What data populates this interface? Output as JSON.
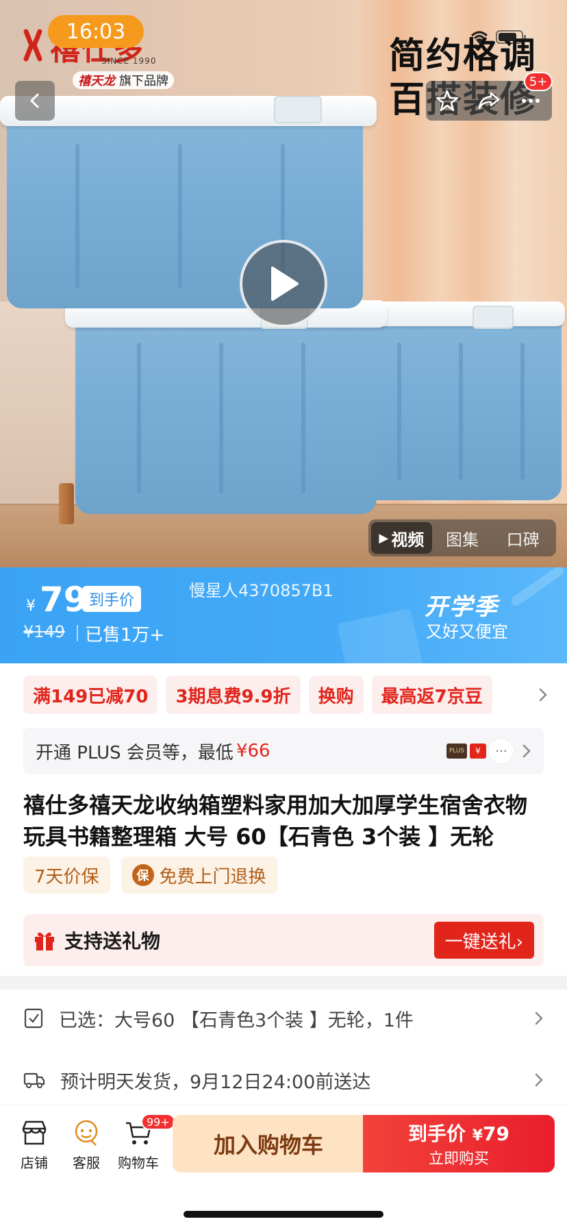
{
  "status_bar": {
    "time": "16:03"
  },
  "hero": {
    "brand_name": "禧仕多",
    "brand_since": "SINCE 1990",
    "brand_tag_brand": "禧天龙",
    "brand_tag_suffix": "旗下品牌",
    "slogan_line1": "简约格调",
    "slogan_line2": "百搭装修",
    "share_badge": "5+",
    "media_tabs": [
      {
        "label": "视频",
        "active": true
      },
      {
        "label": "图集",
        "active": false
      },
      {
        "label": "口碑",
        "active": false
      }
    ]
  },
  "price_banner": {
    "currency": "¥",
    "price": "79",
    "price_tag": "到手价",
    "original_price": "¥149",
    "sold": "已售1万+",
    "watermark": "慢星人4370857B1",
    "season_title": "开学季",
    "season_sub": "又好又便宜"
  },
  "promos": [
    "满149已减70",
    "3期息费9.9折",
    "换购",
    "最高返7京豆"
  ],
  "plus": {
    "text": "开通 PLUS 会员等，最低",
    "price": "¥66",
    "plus_logo": "PLUS",
    "coupon_logo": "¥"
  },
  "product": {
    "title": "禧仕多禧天龙收纳箱塑料家用加大加厚学生宿舍衣物玩具书籍整理箱 大号 60【石青色 3个装 】无轮"
  },
  "services": [
    {
      "label": "7天价保",
      "icon": ""
    },
    {
      "label": "免费上门退换",
      "icon": "保"
    }
  ],
  "gift": {
    "label": "支持送礼物",
    "button": "一键送礼›"
  },
  "info_rows": {
    "selected": "已选：大号60 【石青色3个装 】无轮，1件",
    "delivery": "预计明天发货，9月12日24:00前送达"
  },
  "bottom_bar": {
    "store": "店铺",
    "service": "客服",
    "cart": "购物车",
    "cart_badge": "99+",
    "add_cart": "加入购物车",
    "buy_line1_label": "到手价",
    "buy_line1_currency": "¥",
    "buy_line1_price": "79",
    "buy_line2": "立即购买"
  },
  "colors": {
    "accent_red": "#e1251b",
    "banner_blue": "#3aa3f5",
    "cart_peach": "#fde3c4"
  }
}
